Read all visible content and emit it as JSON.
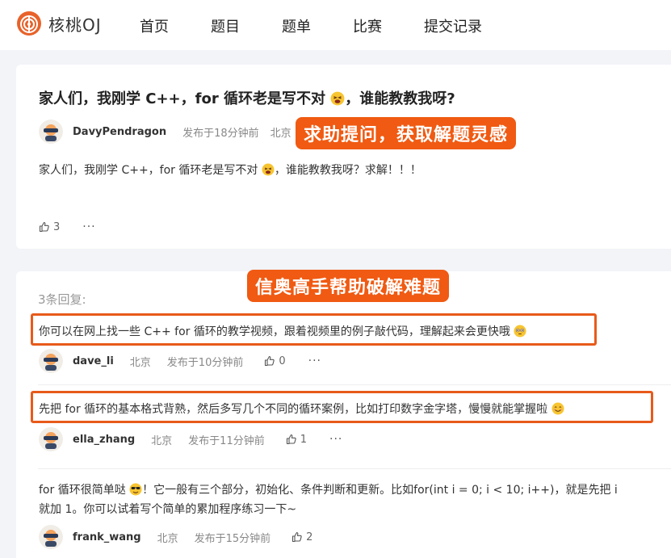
{
  "header": {
    "logo_text": "核桃OJ",
    "nav": [
      "首页",
      "题目",
      "题单",
      "比赛",
      "提交记录"
    ]
  },
  "question": {
    "title": "家人们，我刚学 C++，for 循环老是写不对",
    "title_suffix": "，谁能教教我呀?",
    "author": "DavyPendragon",
    "posted": "发布于18分钟前",
    "location": "北京",
    "body": "家人们，我刚学 C++，for 循环老是写不对",
    "body_suffix": "，谁能教教我呀？求解！！！",
    "likes": "3",
    "more": "···"
  },
  "banners": {
    "help": "求助提问，获取解题灵感",
    "experts": "信奥高手帮助破解难题"
  },
  "replies": {
    "count_label": "3条回复:",
    "items": [
      {
        "text": "你可以在网上找一些 C++ for 循环的教学视频，跟着视频里的例子敲代码，理解起来会更快哦",
        "author": "dave_li",
        "location": "北京",
        "posted": "发布于10分钟前",
        "likes": "0",
        "more": "···"
      },
      {
        "text": "先把 for 循环的基本格式背熟，然后多写几个不同的循环案例，比如打印数字金字塔，慢慢就能掌握啦",
        "author": "ella_zhang",
        "location": "北京",
        "posted": "发布于11分钟前",
        "likes": "1",
        "more": "···"
      },
      {
        "text_prefix": "for 循环很简单哒",
        "text_line1": "！它一般有三个部分，初始化、条件判断和更新。比如for(int i = 0; i < 10; i++)，就是先把 i",
        "text_line2": "就加 1。你可以试着写个简单的累加程序练习一下~",
        "author": "frank_wang",
        "location": "北京",
        "posted": "发布于15分钟前",
        "likes": "2",
        "more": "···"
      }
    ]
  },
  "colors": {
    "accent": "#f05a12",
    "highlight_border": "#e85a1a",
    "background": "#f2f4f8"
  }
}
